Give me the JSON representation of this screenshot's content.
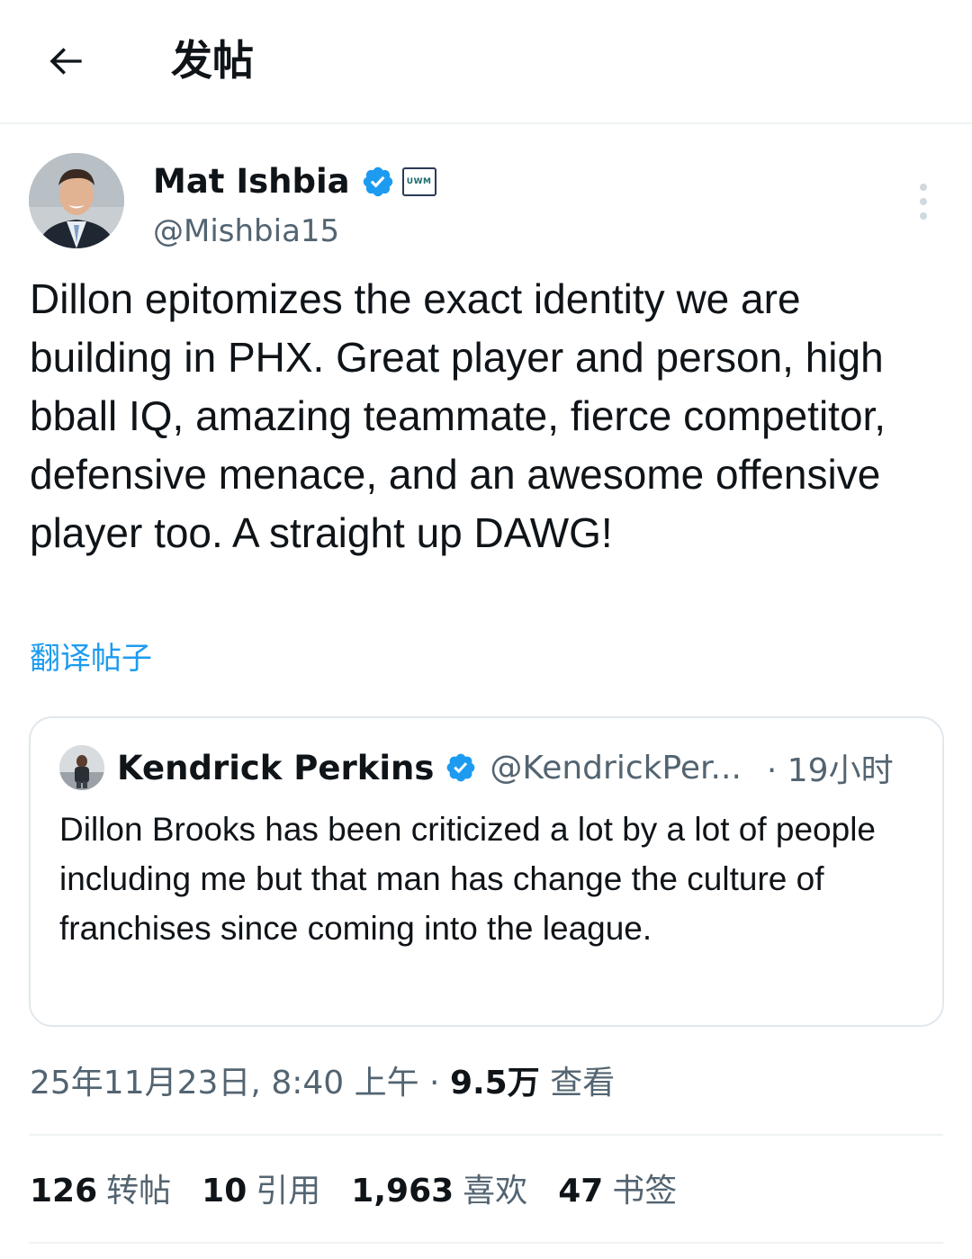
{
  "header": {
    "title": "发帖"
  },
  "tweet": {
    "author": {
      "name": "Mat Ishbia",
      "handle": "@Mishbia15",
      "affiliation_badge": "UWM"
    },
    "text": "Dillon epitomizes the exact identity we are building in PHX. Great player and person, high bball IQ, amazing teammate, fierce competitor, defensive menace, and an awesome offensive player too. A straight up DAWG!",
    "translate_label": "翻译帖子",
    "quote": {
      "author_name": "Kendrick Perkins",
      "handle": "@KendrickPer...",
      "time": "· 19小时",
      "text": "Dillon Brooks has been criticized a lot by a lot of people including me but that man has change the culture of franchises since coming into the league."
    },
    "timestamp": "25年11月23日, 8:40 上午 ·",
    "views_count": "9.5万",
    "views_label": "查看",
    "stats": {
      "retweets_count": "126",
      "retweets_label": "转帖",
      "quotes_count": "10",
      "quotes_label": "引用",
      "likes_count": "1,963",
      "likes_label": "喜欢",
      "bookmarks_count": "47",
      "bookmarks_label": "书签"
    }
  },
  "icons": {
    "back": "arrow-left-icon",
    "verified": "verified-badge-icon",
    "more": "more-vertical-icon"
  },
  "colors": {
    "accent": "#1d9bf0",
    "text_primary": "#0f1419",
    "text_secondary": "#536471",
    "divider": "#eff3f4",
    "card_border": "#e1e8ed"
  }
}
